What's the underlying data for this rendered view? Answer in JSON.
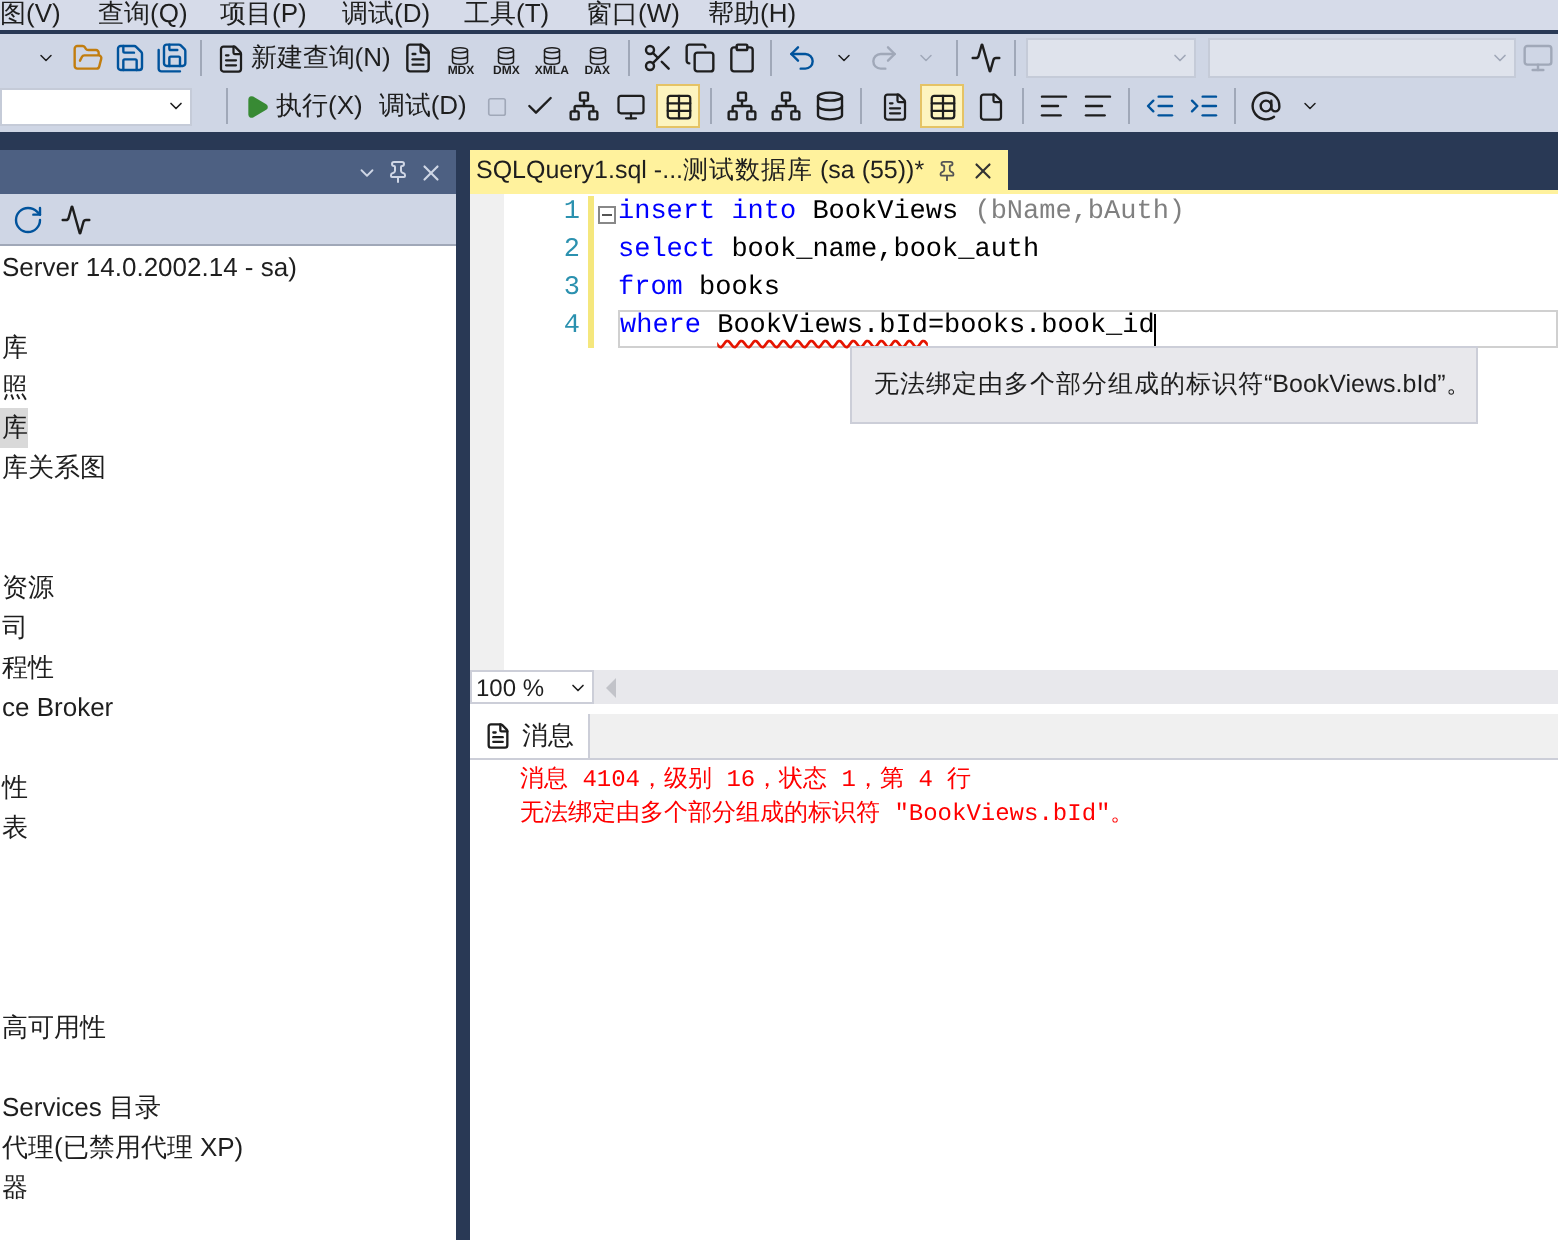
{
  "menu": [
    "图(V)",
    "查询(Q)",
    "项目(P)",
    "调试(D)",
    "工具(T)",
    "窗口(W)",
    "帮助(H)"
  ],
  "toolbar1": {
    "new_query": "新建查询(N)",
    "query_type_labels": [
      "MDX",
      "DMX",
      "XMLA",
      "DAX"
    ]
  },
  "toolbar2": {
    "execute": "执行(X)",
    "debug": "调试(D)",
    "result_toggles": [
      {
        "selected": false
      },
      {
        "selected": true
      }
    ],
    "plan_toggles": [
      {
        "selected": false
      },
      {
        "selected": true
      },
      {
        "selected": false
      }
    ]
  },
  "explorer": {
    "rows": [
      {
        "kind": "text",
        "text": "Server 14.0.2002.14 - sa)",
        "selected": false
      },
      {
        "kind": "blank",
        "selected": false
      },
      {
        "kind": "text",
        "text": "库",
        "selected": false
      },
      {
        "kind": "text",
        "text": "照",
        "selected": false
      },
      {
        "kind": "text",
        "text": "库",
        "selected": true
      },
      {
        "kind": "text",
        "text": "库关系图",
        "selected": false
      },
      {
        "kind": "blank",
        "selected": false
      },
      {
        "kind": "blank",
        "selected": false
      },
      {
        "kind": "text",
        "text": "资源",
        "selected": false
      },
      {
        "kind": "text",
        "text": "司",
        "selected": false
      },
      {
        "kind": "text",
        "text": "程性",
        "selected": false
      },
      {
        "kind": "text",
        "text": "ce Broker",
        "selected": false
      },
      {
        "kind": "blank",
        "selected": false
      },
      {
        "kind": "text",
        "text": "性",
        "selected": false
      },
      {
        "kind": "text",
        "text": "表",
        "selected": false
      },
      {
        "kind": "blank",
        "selected": false
      },
      {
        "kind": "blank",
        "selected": false
      },
      {
        "kind": "blank",
        "selected": false
      },
      {
        "kind": "blank",
        "selected": false
      },
      {
        "kind": "text",
        "text": "高可用性",
        "selected": false
      },
      {
        "kind": "blank",
        "selected": false
      },
      {
        "kind": "text",
        "text": "Services 目录",
        "selected": false
      },
      {
        "kind": "text",
        "text": "代理(已禁用代理 XP)",
        "selected": false
      },
      {
        "kind": "text",
        "text": "器",
        "selected": false
      }
    ]
  },
  "editor": {
    "tab": "SQLQuery1.sql -...测试数据库 (sa (55))*",
    "lines": [
      {
        "number": "1",
        "tokens": [
          {
            "kind": "keyword",
            "text": "insert"
          },
          {
            "kind": "keyword",
            "text": "into"
          },
          {
            "kind": "plain",
            "text": "BookViews"
          },
          {
            "kind": "punct",
            "text": "(bName,bAuth)"
          }
        ]
      },
      {
        "number": "2",
        "tokens": [
          {
            "kind": "keyword",
            "text": "select"
          },
          {
            "kind": "plain",
            "text": "book_name,book_auth"
          }
        ]
      },
      {
        "number": "3",
        "tokens": [
          {
            "kind": "keyword",
            "text": "from"
          },
          {
            "kind": "plain",
            "text": "books"
          }
        ]
      },
      {
        "number": "4",
        "tokens": [
          {
            "kind": "keyword",
            "text": "where"
          },
          {
            "kind": "error",
            "text": "BookViews.bId"
          },
          {
            "kind": "plain",
            "text": "=books.book_id"
          }
        ]
      }
    ],
    "tooltip": "无法绑定由多个部分组成的标识符“BookViews.bId”。",
    "zoom": "100 %"
  },
  "results": {
    "tab": "消息",
    "messages": [
      "消息 4104，级别 16，状态 1，第 4 行",
      "无法绑定由多个部分组成的标识符 \"BookViews.bId\"。"
    ]
  }
}
